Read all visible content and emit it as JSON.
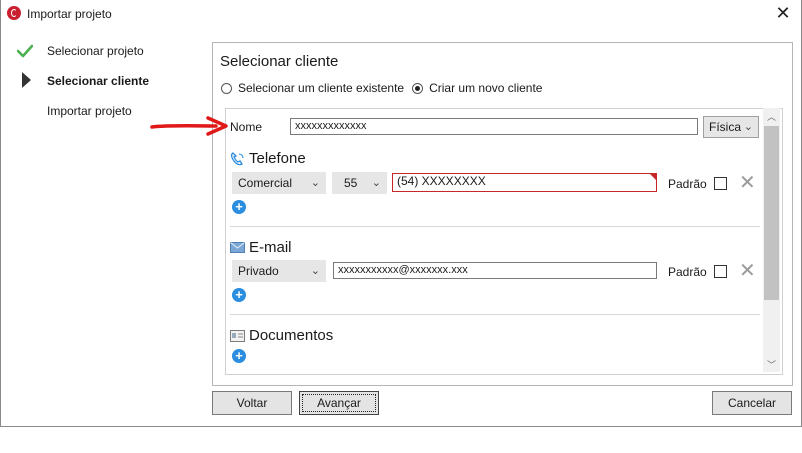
{
  "window": {
    "title": "Importar projeto"
  },
  "steps": [
    {
      "label": "Selecionar projeto",
      "state": "done"
    },
    {
      "label": "Selecionar cliente",
      "state": "current"
    },
    {
      "label": "Importar projeto",
      "state": "pending"
    }
  ],
  "panel": {
    "title": "Selecionar cliente",
    "radio_existing": "Selecionar um cliente existente",
    "radio_new": "Criar um novo cliente",
    "selected_radio": "new"
  },
  "form": {
    "name_label": "Nome",
    "name_value": "xxxxxxxxxxxxx",
    "person_type": "Física",
    "phone": {
      "title": "Telefone",
      "type": "Comercial",
      "country_code": "55",
      "number": "(54) XXXXXXXX",
      "default_label": "Padrão"
    },
    "email": {
      "title": "E-mail",
      "type": "Privado",
      "address": "xxxxxxxxxxx@xxxxxxx.xxx",
      "default_label": "Padrão"
    },
    "documents": {
      "title": "Documentos"
    }
  },
  "buttons": {
    "back": "Voltar",
    "next": "Avançar",
    "cancel": "Cancelar"
  },
  "colors": {
    "accent_blue": "#2a8de0",
    "error_red": "#c62828",
    "check_green": "#4caf50",
    "arrow_red": "#e01818"
  }
}
